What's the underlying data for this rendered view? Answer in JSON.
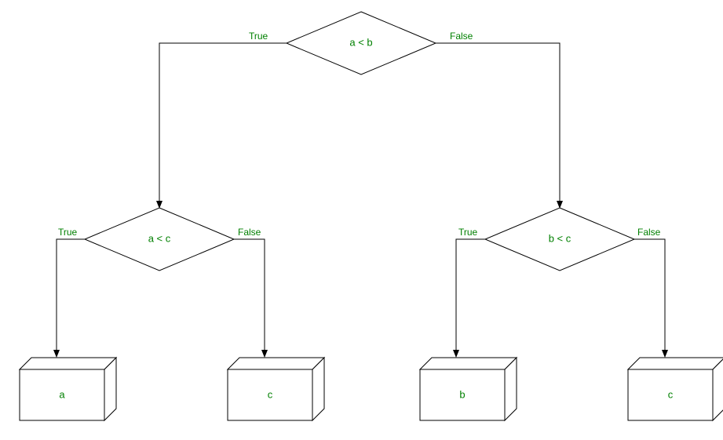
{
  "diagram": {
    "decisions": {
      "top": {
        "label": "a < b",
        "true_label": "True",
        "false_label": "False"
      },
      "left": {
        "label": "a < c",
        "true_label": "True",
        "false_label": "False"
      },
      "right": {
        "label": "b < c",
        "true_label": "True",
        "false_label": "False"
      }
    },
    "outputs": {
      "out1": "a",
      "out2": "c",
      "out3": "b",
      "out4": "c"
    }
  }
}
